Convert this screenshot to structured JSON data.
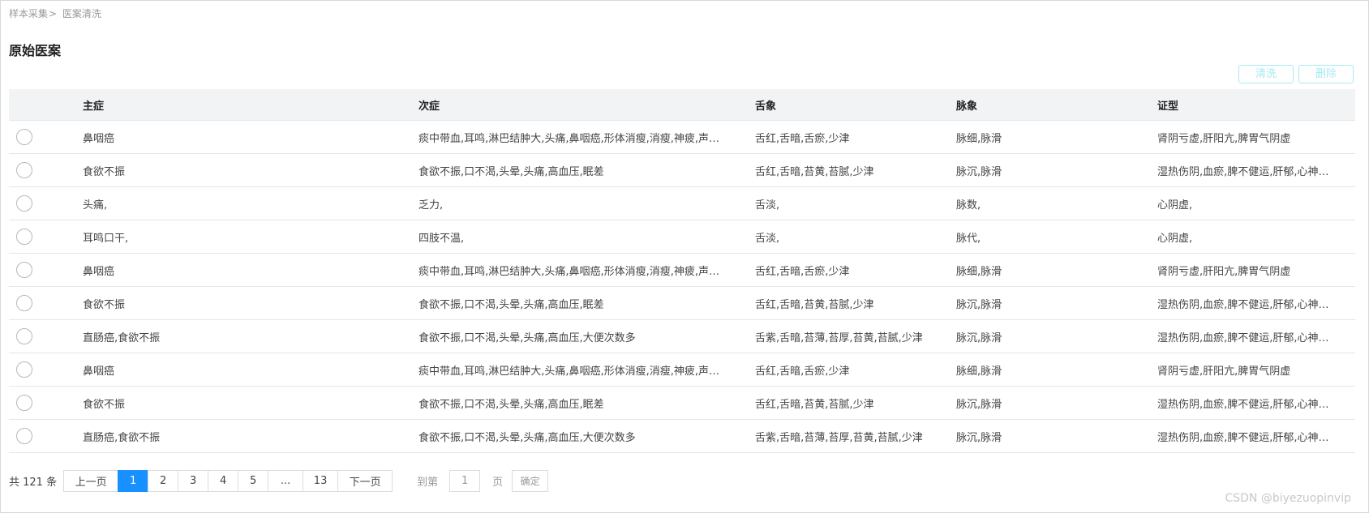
{
  "breadcrumb": {
    "items": [
      "样本采集",
      "医案清洗"
    ],
    "separator": ">"
  },
  "page": {
    "title": "原始医案"
  },
  "toolbar": {
    "clean_label": "清洗",
    "delete_label": "删除"
  },
  "table": {
    "headers": [
      "主症",
      "次症",
      "舌象",
      "脉象",
      "证型"
    ],
    "rows": [
      [
        "鼻咽癌",
        "痰中带血,耳鸣,淋巴结肿大,头痛,鼻咽癌,形体消瘦,消瘦,神疲,声…",
        "舌红,舌暗,舌瘀,少津",
        "脉细,脉滑",
        "肾阴亏虚,肝阳亢,脾胃气阴虚"
      ],
      [
        "食欲不振",
        "食欲不振,口不渴,头晕,头痛,高血压,眠差",
        "舌红,舌暗,苔黄,苔腻,少津",
        "脉沉,脉滑",
        "湿热伤阴,血瘀,脾不健运,肝郁,心神…"
      ],
      [
        "头痛,",
        "乏力,",
        "舌淡,",
        "脉数,",
        "心阴虚,"
      ],
      [
        "耳鸣口干,",
        "四肢不温,",
        "舌淡,",
        "脉代,",
        "心阴虚,"
      ],
      [
        "鼻咽癌",
        "痰中带血,耳鸣,淋巴结肿大,头痛,鼻咽癌,形体消瘦,消瘦,神疲,声…",
        "舌红,舌暗,舌瘀,少津",
        "脉细,脉滑",
        "肾阴亏虚,肝阳亢,脾胃气阴虚"
      ],
      [
        "食欲不振",
        "食欲不振,口不渴,头晕,头痛,高血压,眠差",
        "舌红,舌暗,苔黄,苔腻,少津",
        "脉沉,脉滑",
        "湿热伤阴,血瘀,脾不健运,肝郁,心神…"
      ],
      [
        "直肠癌,食欲不振",
        "食欲不振,口不渴,头晕,头痛,高血压,大便次数多",
        "舌紫,舌暗,苔薄,苔厚,苔黄,苔腻,少津",
        "脉沉,脉滑",
        "湿热伤阴,血瘀,脾不健运,肝郁,心神…"
      ],
      [
        "鼻咽癌",
        "痰中带血,耳鸣,淋巴结肿大,头痛,鼻咽癌,形体消瘦,消瘦,神疲,声…",
        "舌红,舌暗,舌瘀,少津",
        "脉细,脉滑",
        "肾阴亏虚,肝阳亢,脾胃气阴虚"
      ],
      [
        "食欲不振",
        "食欲不振,口不渴,头晕,头痛,高血压,眠差",
        "舌红,舌暗,苔黄,苔腻,少津",
        "脉沉,脉滑",
        "湿热伤阴,血瘀,脾不健运,肝郁,心神…"
      ],
      [
        "直肠癌,食欲不振",
        "食欲不振,口不渴,头晕,头痛,高血压,大便次数多",
        "舌紫,舌暗,苔薄,苔厚,苔黄,苔腻,少津",
        "脉沉,脉滑",
        "湿热伤阴,血瘀,脾不健运,肝郁,心神…"
      ]
    ]
  },
  "pagination": {
    "total_text": "共 121 条",
    "prev_label": "上一页",
    "next_label": "下一页",
    "pages": [
      "1",
      "2",
      "3",
      "4",
      "5",
      "...",
      "13"
    ],
    "current": "1",
    "goto_label": "到第",
    "goto_value": "1",
    "page_suffix": "页",
    "confirm_label": "确定"
  },
  "watermark": "CSDN @biyezuopinvip",
  "colors": {
    "accent": "#1890ff",
    "disabled_button": "#a6e9f3",
    "header_bg": "#f2f3f5"
  }
}
